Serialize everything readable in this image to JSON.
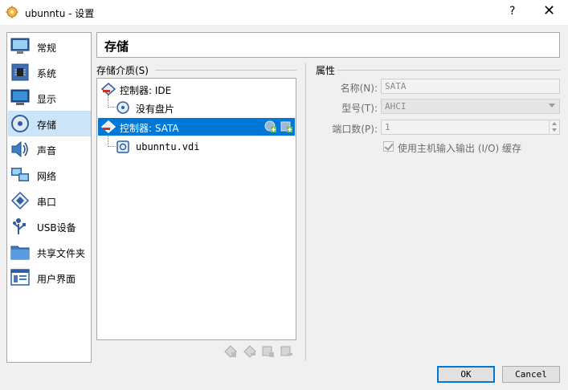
{
  "window": {
    "title": "ubunntu - 设置",
    "help": "?",
    "close": "✕"
  },
  "nav": {
    "items": [
      {
        "label": "常规",
        "icon": "general-icon"
      },
      {
        "label": "系统",
        "icon": "system-icon"
      },
      {
        "label": "显示",
        "icon": "display-icon"
      },
      {
        "label": "存储",
        "icon": "storage-icon"
      },
      {
        "label": "声音",
        "icon": "audio-icon"
      },
      {
        "label": "网络",
        "icon": "network-icon"
      },
      {
        "label": "串口",
        "icon": "serial-port-icon"
      },
      {
        "label": "USB设备",
        "icon": "usb-icon"
      },
      {
        "label": "共享文件夹",
        "icon": "shared-folder-icon"
      },
      {
        "label": "用户界面",
        "icon": "user-interface-icon"
      }
    ],
    "selected": "存储"
  },
  "page": {
    "title": "存储"
  },
  "storage": {
    "header": "存储介质(S)",
    "tree": [
      {
        "label": "控制器: IDE"
      },
      {
        "label": "没有盘片"
      },
      {
        "label": "控制器: SATA"
      },
      {
        "label": "ubunntu.vdi"
      }
    ]
  },
  "attributes": {
    "header": "属性",
    "name_label": "名称(N):",
    "name_value": "SATA",
    "type_label": "型号(T):",
    "type_value": "AHCI",
    "ports_label": "端口数(P):",
    "ports_value": "1",
    "host_cache_label": "使用主机输入输出 (I/O) 缓存"
  },
  "buttons": {
    "ok": "OK",
    "cancel": "Cancel"
  },
  "colors": {
    "selection": "#0078d7",
    "nav_selected": "#cce4f7"
  }
}
